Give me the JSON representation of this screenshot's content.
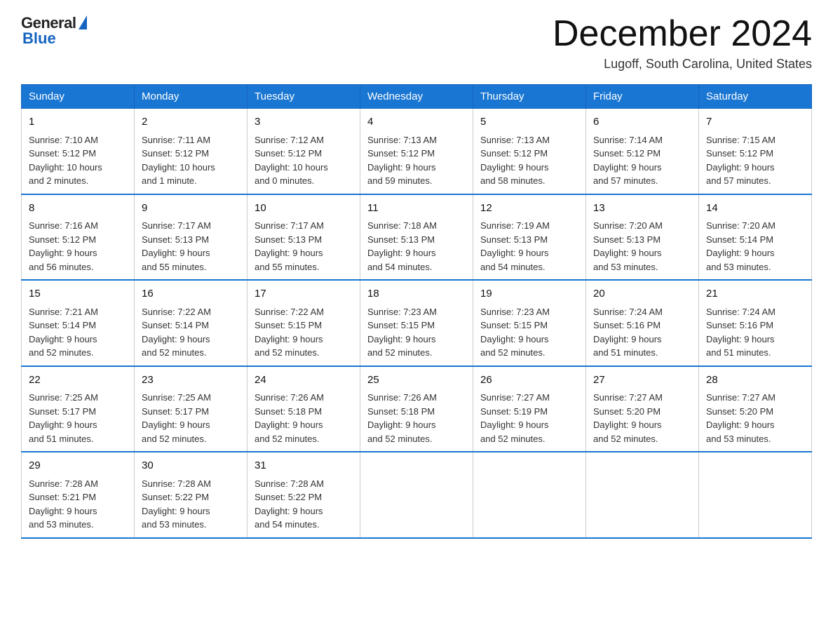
{
  "header": {
    "logo_general": "General",
    "logo_blue": "Blue",
    "month_title": "December 2024",
    "location": "Lugoff, South Carolina, United States"
  },
  "days_of_week": [
    "Sunday",
    "Monday",
    "Tuesday",
    "Wednesday",
    "Thursday",
    "Friday",
    "Saturday"
  ],
  "weeks": [
    [
      {
        "day": "1",
        "sunrise": "7:10 AM",
        "sunset": "5:12 PM",
        "daylight": "10 hours and 2 minutes."
      },
      {
        "day": "2",
        "sunrise": "7:11 AM",
        "sunset": "5:12 PM",
        "daylight": "10 hours and 1 minute."
      },
      {
        "day": "3",
        "sunrise": "7:12 AM",
        "sunset": "5:12 PM",
        "daylight": "10 hours and 0 minutes."
      },
      {
        "day": "4",
        "sunrise": "7:13 AM",
        "sunset": "5:12 PM",
        "daylight": "9 hours and 59 minutes."
      },
      {
        "day": "5",
        "sunrise": "7:13 AM",
        "sunset": "5:12 PM",
        "daylight": "9 hours and 58 minutes."
      },
      {
        "day": "6",
        "sunrise": "7:14 AM",
        "sunset": "5:12 PM",
        "daylight": "9 hours and 57 minutes."
      },
      {
        "day": "7",
        "sunrise": "7:15 AM",
        "sunset": "5:12 PM",
        "daylight": "9 hours and 57 minutes."
      }
    ],
    [
      {
        "day": "8",
        "sunrise": "7:16 AM",
        "sunset": "5:12 PM",
        "daylight": "9 hours and 56 minutes."
      },
      {
        "day": "9",
        "sunrise": "7:17 AM",
        "sunset": "5:13 PM",
        "daylight": "9 hours and 55 minutes."
      },
      {
        "day": "10",
        "sunrise": "7:17 AM",
        "sunset": "5:13 PM",
        "daylight": "9 hours and 55 minutes."
      },
      {
        "day": "11",
        "sunrise": "7:18 AM",
        "sunset": "5:13 PM",
        "daylight": "9 hours and 54 minutes."
      },
      {
        "day": "12",
        "sunrise": "7:19 AM",
        "sunset": "5:13 PM",
        "daylight": "9 hours and 54 minutes."
      },
      {
        "day": "13",
        "sunrise": "7:20 AM",
        "sunset": "5:13 PM",
        "daylight": "9 hours and 53 minutes."
      },
      {
        "day": "14",
        "sunrise": "7:20 AM",
        "sunset": "5:14 PM",
        "daylight": "9 hours and 53 minutes."
      }
    ],
    [
      {
        "day": "15",
        "sunrise": "7:21 AM",
        "sunset": "5:14 PM",
        "daylight": "9 hours and 52 minutes."
      },
      {
        "day": "16",
        "sunrise": "7:22 AM",
        "sunset": "5:14 PM",
        "daylight": "9 hours and 52 minutes."
      },
      {
        "day": "17",
        "sunrise": "7:22 AM",
        "sunset": "5:15 PM",
        "daylight": "9 hours and 52 minutes."
      },
      {
        "day": "18",
        "sunrise": "7:23 AM",
        "sunset": "5:15 PM",
        "daylight": "9 hours and 52 minutes."
      },
      {
        "day": "19",
        "sunrise": "7:23 AM",
        "sunset": "5:15 PM",
        "daylight": "9 hours and 52 minutes."
      },
      {
        "day": "20",
        "sunrise": "7:24 AM",
        "sunset": "5:16 PM",
        "daylight": "9 hours and 51 minutes."
      },
      {
        "day": "21",
        "sunrise": "7:24 AM",
        "sunset": "5:16 PM",
        "daylight": "9 hours and 51 minutes."
      }
    ],
    [
      {
        "day": "22",
        "sunrise": "7:25 AM",
        "sunset": "5:17 PM",
        "daylight": "9 hours and 51 minutes."
      },
      {
        "day": "23",
        "sunrise": "7:25 AM",
        "sunset": "5:17 PM",
        "daylight": "9 hours and 52 minutes."
      },
      {
        "day": "24",
        "sunrise": "7:26 AM",
        "sunset": "5:18 PM",
        "daylight": "9 hours and 52 minutes."
      },
      {
        "day": "25",
        "sunrise": "7:26 AM",
        "sunset": "5:18 PM",
        "daylight": "9 hours and 52 minutes."
      },
      {
        "day": "26",
        "sunrise": "7:27 AM",
        "sunset": "5:19 PM",
        "daylight": "9 hours and 52 minutes."
      },
      {
        "day": "27",
        "sunrise": "7:27 AM",
        "sunset": "5:20 PM",
        "daylight": "9 hours and 52 minutes."
      },
      {
        "day": "28",
        "sunrise": "7:27 AM",
        "sunset": "5:20 PM",
        "daylight": "9 hours and 53 minutes."
      }
    ],
    [
      {
        "day": "29",
        "sunrise": "7:28 AM",
        "sunset": "5:21 PM",
        "daylight": "9 hours and 53 minutes."
      },
      {
        "day": "30",
        "sunrise": "7:28 AM",
        "sunset": "5:22 PM",
        "daylight": "9 hours and 53 minutes."
      },
      {
        "day": "31",
        "sunrise": "7:28 AM",
        "sunset": "5:22 PM",
        "daylight": "9 hours and 54 minutes."
      },
      null,
      null,
      null,
      null
    ]
  ],
  "labels": {
    "sunrise": "Sunrise:",
    "sunset": "Sunset:",
    "daylight": "Daylight:"
  }
}
